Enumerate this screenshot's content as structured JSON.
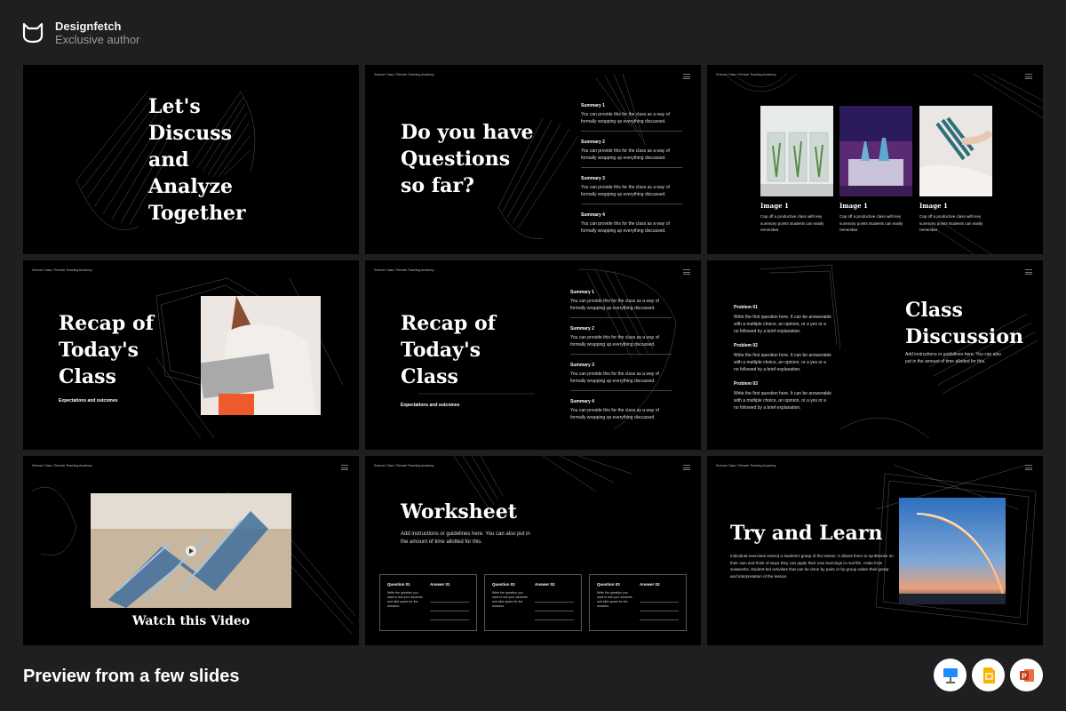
{
  "brand": {
    "name": "Designfetch",
    "role": "Exclusive author"
  },
  "footer": {
    "title": "Preview from a few slides"
  },
  "slide_header": "Science Class / Remote Teaching Academy",
  "slides": {
    "s1": {
      "title_lines": [
        "Let's",
        "Discuss",
        "and",
        "Analyze",
        "Together"
      ]
    },
    "s2": {
      "title_lines": [
        "Do you have",
        "Questions",
        "so far?"
      ],
      "summaries": [
        {
          "title": "Summary 1",
          "text": "You can provide this for the class as a way of formally wrapping up everything discussed."
        },
        {
          "title": "Summary 2",
          "text": "You can provide this for the class as a way of formally wrapping up everything discussed."
        },
        {
          "title": "Summary 3",
          "text": "You can provide this for the class as a way of formally wrapping up everything discussed."
        },
        {
          "title": "Summary 4",
          "text": "You can provide this for the class as a way of formally wrapping up everything discussed."
        }
      ]
    },
    "s3": {
      "images": [
        {
          "caption": "Image 1",
          "text": "Cap off a productive class with key summary points students can easily remember."
        },
        {
          "caption": "Image 1",
          "text": "Cap off a productive class with key summary points students can easily remember."
        },
        {
          "caption": "Image 1",
          "text": "Cap off a productive class with key summary points students can easily remember."
        }
      ]
    },
    "s4": {
      "title_lines": [
        "Recap of",
        "Today's",
        "Class"
      ],
      "subtitle": "Expectations and outcomes"
    },
    "s5": {
      "title_lines": [
        "Recap of",
        "Today's",
        "Class"
      ],
      "subtitle": "Expectations and outcomes",
      "summaries": [
        {
          "title": "Summary 1",
          "text": "You can provide this for the class as a way of formally wrapping up everything discussed."
        },
        {
          "title": "Summary 2",
          "text": "You can provide this for the class as a way of formally wrapping up everything discussed."
        },
        {
          "title": "Summary 3",
          "text": "You can provide this for the class as a way of formally wrapping up everything discussed."
        },
        {
          "title": "Summary 4",
          "text": "You can provide this for the class as a way of formally wrapping up everything discussed."
        }
      ]
    },
    "s6": {
      "title_lines": [
        "Class",
        "Discussion"
      ],
      "subtitle": "Add instructions or guidelines here. You can also put in the amount of time allotted for this.",
      "problems": [
        {
          "title": "Problem 01",
          "text": "Write the first question here. It can be answerable with a multiple choice, an opinion, or a yes or a no followed by a brief explanation."
        },
        {
          "title": "Problem 02",
          "text": "Write the first question here. It can be answerable with a multiple choice, an opinion, or a yes or a no followed by a brief explanation."
        },
        {
          "title": "Problem 03",
          "text": "Write the first question here. It can be answerable with a multiple choice, an opinion, or a yes or a no followed by a brief explanation."
        }
      ]
    },
    "s7": {
      "caption": "Watch this Video"
    },
    "s8": {
      "title": "Worksheet",
      "subtitle": "Add instructions or guidelines here. You can also put in the amount of time allotted for this.",
      "boxes": [
        {
          "q": "Question 01",
          "a": "Answer 01",
          "desc": "Write the question you want to ask your students and allot space for the answers."
        },
        {
          "q": "Question 02",
          "a": "Answer 02",
          "desc": "Write the question you want to ask your students and allot space for the answers."
        },
        {
          "q": "Question 03",
          "a": "Answer 03",
          "desc": "Write the question you want to ask your students and allot space for the answers."
        }
      ]
    },
    "s9": {
      "title": "Try and Learn",
      "text": "Individual exercises extend a student's grasp of the lesson. It allows them to synthesize on their own and think of ways they can apply their new learnings in real life. Aside from seatworks, student-led activities that can be done by pairs or by group widen their grasp and interpretation of the lesson."
    }
  },
  "apps": [
    {
      "name": "keynote-icon",
      "color": "#1a8cff"
    },
    {
      "name": "google-slides-icon",
      "color": "#f4b400"
    },
    {
      "name": "powerpoint-icon",
      "color": "#d24726"
    }
  ]
}
